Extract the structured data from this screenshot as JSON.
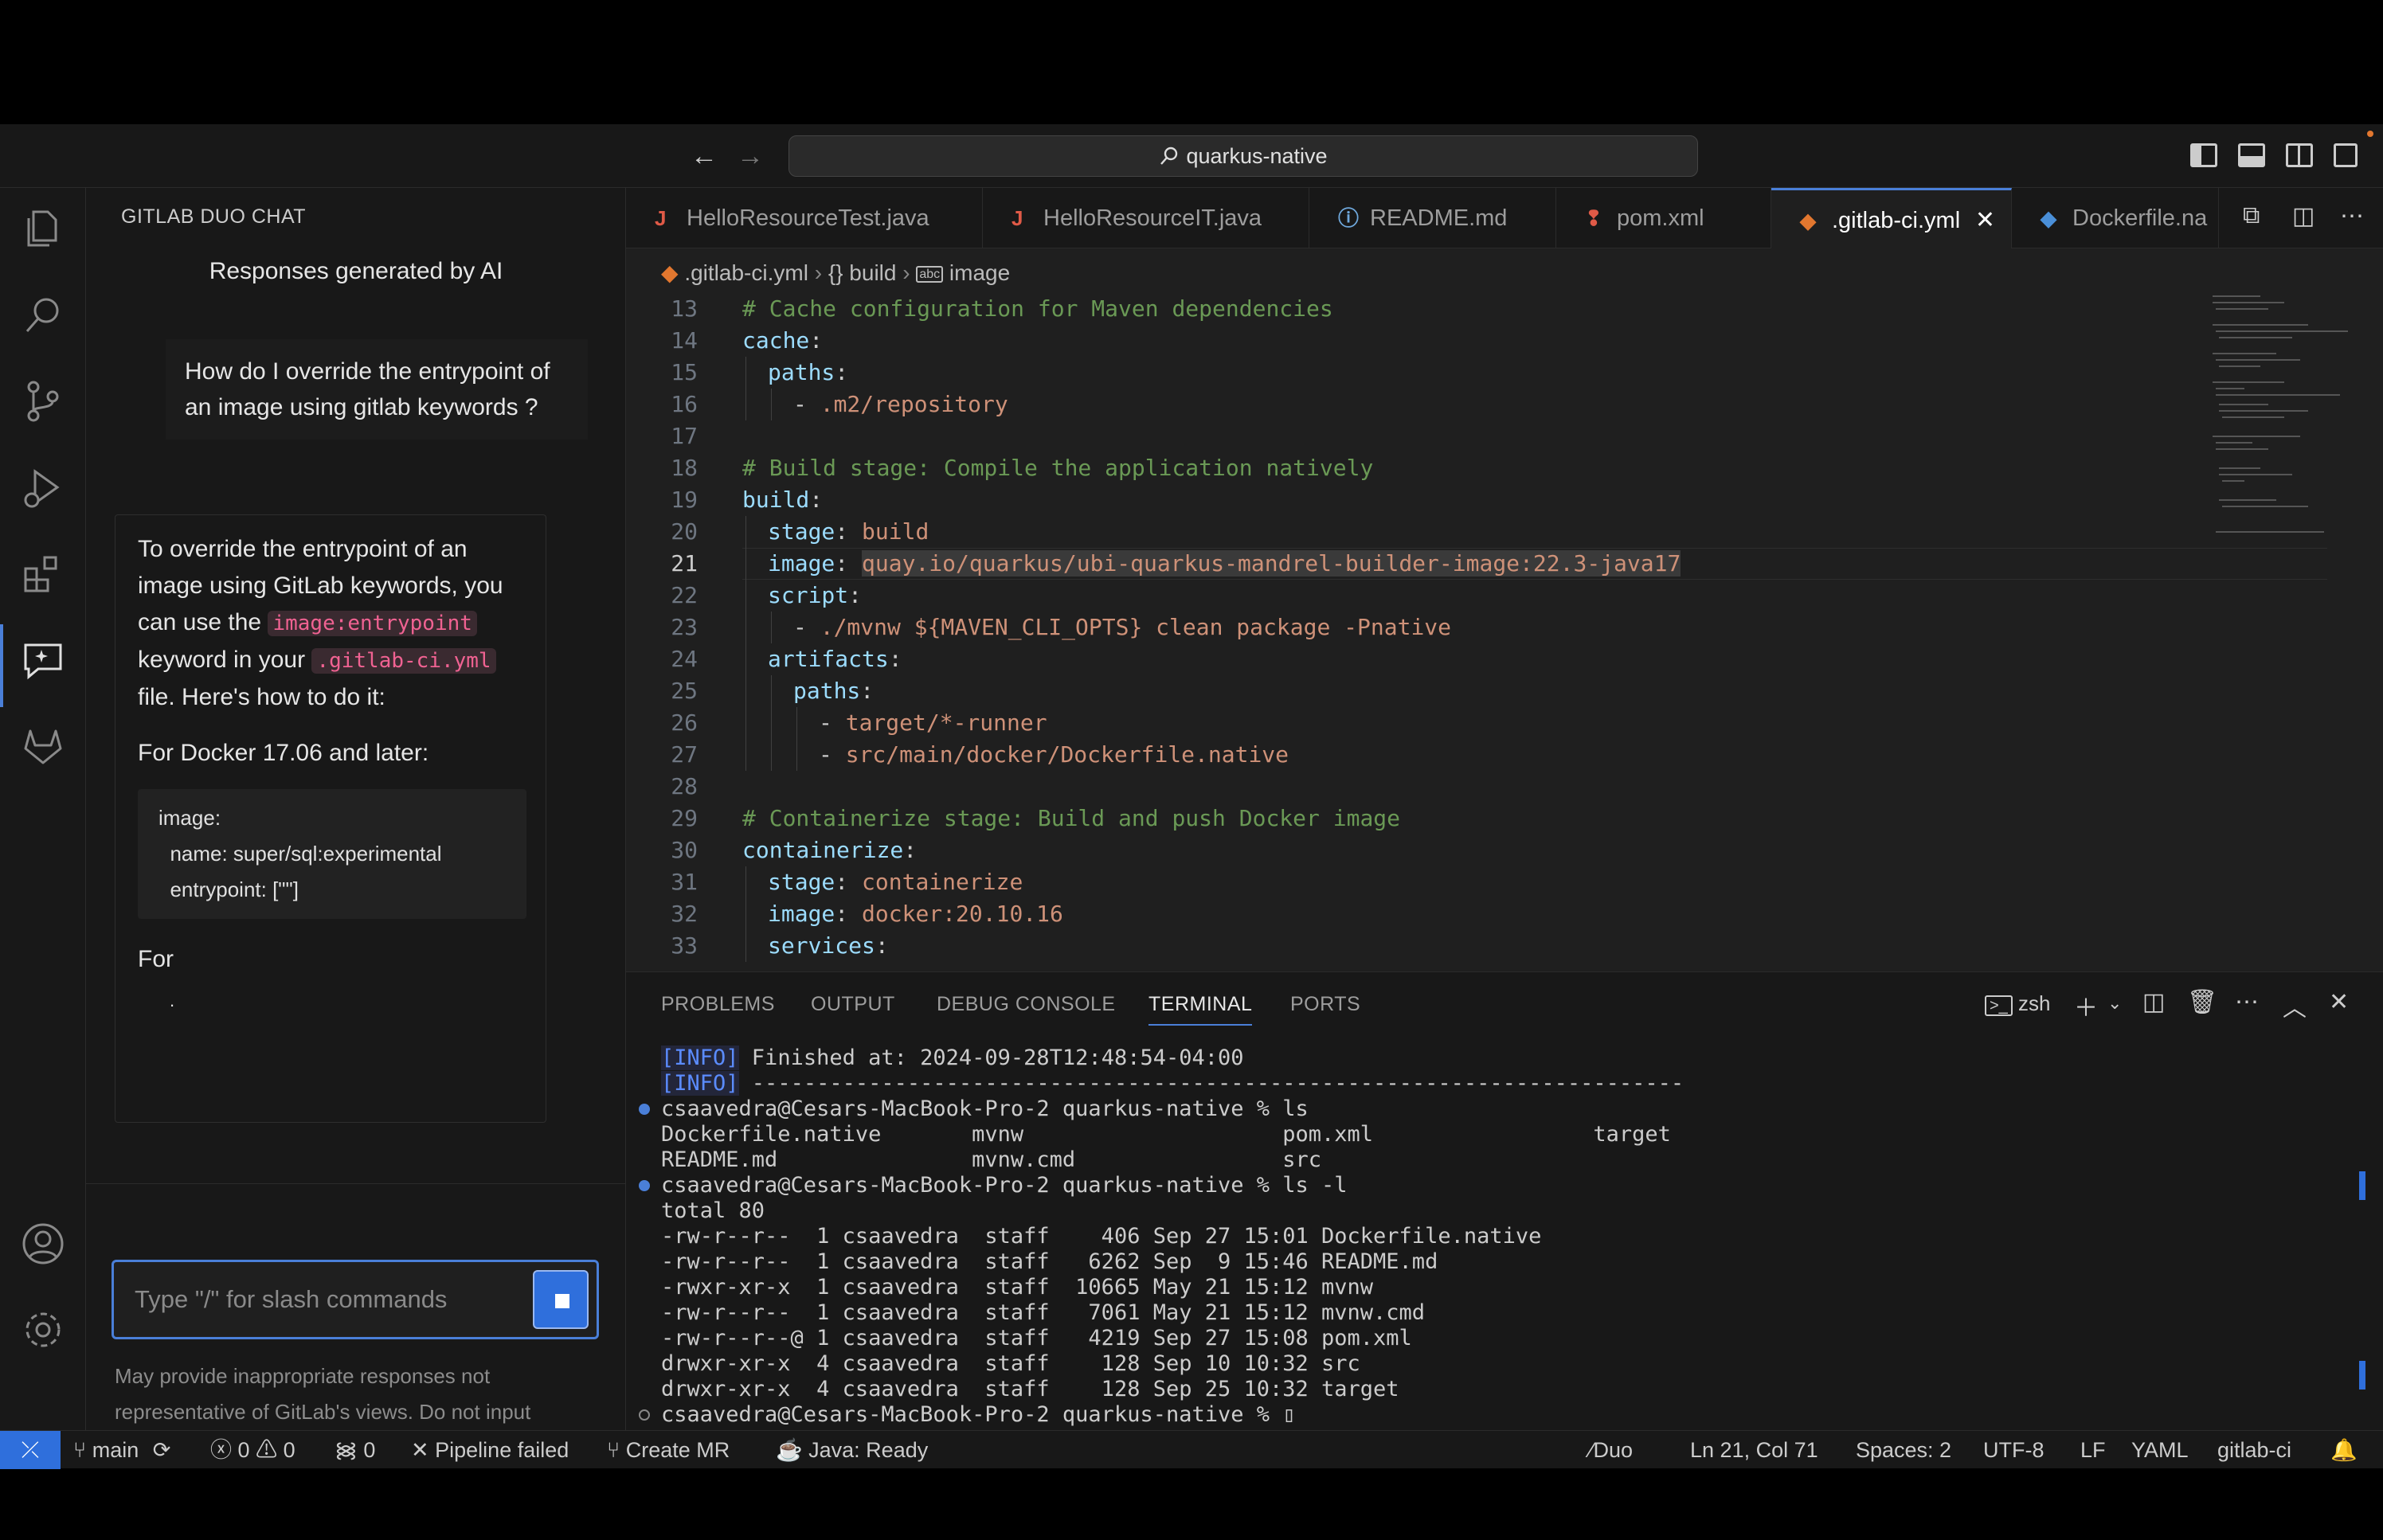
{
  "titlebar": {
    "search_text": "quarkus-native"
  },
  "chat": {
    "title": "GITLAB DUO CHAT",
    "subtitle": "Responses generated by AI",
    "question": "How do I override the entrypoint of an image using gitlab keywords ?",
    "answer_part1": "To override the entrypoint of an image using GitLab keywords, you can use the ",
    "answer_code1": "image:entrypoint",
    "answer_part2": " keyword in your ",
    "answer_code2": ".gitlab-ci.yml",
    "answer_part3": " file. Here's how to do it:",
    "answer_docker": "For Docker 17.06 and later:",
    "code_block": "image:\n  name: super/sql:experimental\n  entrypoint: [\"\"]",
    "answer_for": "For",
    "answer_dot": ".",
    "input_placeholder": "Type \"/\" for slash commands",
    "disclaimer": "May provide inappropriate responses not representative of GitLab's views. Do not input personal data."
  },
  "tabs": [
    {
      "label": "HelloResourceTest.java",
      "icon": "J",
      "color": "#e05a47"
    },
    {
      "label": "HelloResourceIT.java",
      "icon": "J",
      "color": "#e05a47"
    },
    {
      "label": "README.md",
      "icon": "ⓘ",
      "color": "#6fa8dc"
    },
    {
      "label": "pom.xml",
      "icon": "❢",
      "color": "#e05a47"
    },
    {
      "label": ".gitlab-ci.yml",
      "icon": "◆",
      "color": "#e2772f"
    },
    {
      "label": "Dockerfile.na",
      "icon": "◆",
      "color": "#4a8fd8"
    }
  ],
  "breadcrumb": {
    "file": ".gitlab-ci.yml",
    "section": "{} build",
    "key": "image"
  },
  "editor": {
    "current_line": 21,
    "lines": [
      {
        "n": "13",
        "indent": 0,
        "tokens": [
          {
            "c": "c",
            "t": "# Cache configuration for Maven dependencies"
          }
        ]
      },
      {
        "n": "14",
        "indent": 0,
        "tokens": [
          {
            "c": "k",
            "t": "cache"
          },
          {
            "c": "p",
            "t": ":"
          }
        ]
      },
      {
        "n": "15",
        "indent": 1,
        "tokens": [
          {
            "c": "k",
            "t": "paths"
          },
          {
            "c": "p",
            "t": ":"
          }
        ]
      },
      {
        "n": "16",
        "indent": 2,
        "tokens": [
          {
            "c": "p",
            "t": "- "
          },
          {
            "c": "s",
            "t": ".m2/repository"
          }
        ]
      },
      {
        "n": "17",
        "indent": 0,
        "tokens": []
      },
      {
        "n": "18",
        "indent": 0,
        "tokens": [
          {
            "c": "c",
            "t": "# Build stage: Compile the application natively"
          }
        ]
      },
      {
        "n": "19",
        "indent": 0,
        "tokens": [
          {
            "c": "k",
            "t": "build"
          },
          {
            "c": "p",
            "t": ":"
          }
        ]
      },
      {
        "n": "20",
        "indent": 1,
        "tokens": [
          {
            "c": "k",
            "t": "stage"
          },
          {
            "c": "p",
            "t": ": "
          },
          {
            "c": "s",
            "t": "build"
          }
        ]
      },
      {
        "n": "21",
        "indent": 1,
        "tokens": [
          {
            "c": "k",
            "t": "image"
          },
          {
            "c": "p",
            "t": ": "
          },
          {
            "c": "s hl",
            "t": "quay.io/quarkus/ubi-quarkus-mandrel-builder-image:22.3-java17"
          }
        ]
      },
      {
        "n": "22",
        "indent": 1,
        "tokens": [
          {
            "c": "k",
            "t": "script"
          },
          {
            "c": "p",
            "t": ":"
          }
        ]
      },
      {
        "n": "23",
        "indent": 2,
        "tokens": [
          {
            "c": "p",
            "t": "- "
          },
          {
            "c": "s",
            "t": "./mvnw ${MAVEN_CLI_OPTS} clean package -Pnative"
          }
        ]
      },
      {
        "n": "24",
        "indent": 1,
        "tokens": [
          {
            "c": "k",
            "t": "artifacts"
          },
          {
            "c": "p",
            "t": ":"
          }
        ]
      },
      {
        "n": "25",
        "indent": 2,
        "tokens": [
          {
            "c": "k",
            "t": "paths"
          },
          {
            "c": "p",
            "t": ":"
          }
        ]
      },
      {
        "n": "26",
        "indent": 3,
        "tokens": [
          {
            "c": "p",
            "t": "- "
          },
          {
            "c": "s",
            "t": "target/*-runner"
          }
        ]
      },
      {
        "n": "27",
        "indent": 3,
        "tokens": [
          {
            "c": "p",
            "t": "- "
          },
          {
            "c": "s",
            "t": "src/main/docker/Dockerfile.native"
          }
        ]
      },
      {
        "n": "28",
        "indent": 0,
        "tokens": []
      },
      {
        "n": "29",
        "indent": 0,
        "tokens": [
          {
            "c": "c",
            "t": "# Containerize stage: Build and push Docker image"
          }
        ]
      },
      {
        "n": "30",
        "indent": 0,
        "tokens": [
          {
            "c": "k",
            "t": "containerize"
          },
          {
            "c": "p",
            "t": ":"
          }
        ]
      },
      {
        "n": "31",
        "indent": 1,
        "tokens": [
          {
            "c": "k",
            "t": "stage"
          },
          {
            "c": "p",
            "t": ": "
          },
          {
            "c": "s",
            "t": "containerize"
          }
        ]
      },
      {
        "n": "32",
        "indent": 1,
        "tokens": [
          {
            "c": "k",
            "t": "image"
          },
          {
            "c": "p",
            "t": ": "
          },
          {
            "c": "s",
            "t": "docker:20.10.16"
          }
        ]
      },
      {
        "n": "33",
        "indent": 1,
        "tokens": [
          {
            "c": "k",
            "t": "services"
          },
          {
            "c": "p",
            "t": ":"
          }
        ]
      }
    ]
  },
  "panel": {
    "tabs": [
      "PROBLEMS",
      "OUTPUT",
      "DEBUG CONSOLE",
      "TERMINAL",
      "PORTS"
    ],
    "active_tab": "TERMINAL",
    "shell": "zsh",
    "terminal_lines": [
      {
        "dot": "",
        "info": "[INFO]",
        "t": " Finished at: 2024-09-28T12:48:54-04:00"
      },
      {
        "dot": "",
        "info": "[INFO]",
        "t": " ------------------------------------------------------------------------"
      },
      {
        "dot": "blue",
        "info": "",
        "t": "csaavedra@Cesars-MacBook-Pro-2 quarkus-native % ls"
      },
      {
        "dot": "",
        "info": "",
        "t": "Dockerfile.native       mvnw                    pom.xml                 target"
      },
      {
        "dot": "",
        "info": "",
        "t": "README.md               mvnw.cmd                src"
      },
      {
        "dot": "blue",
        "info": "",
        "t": "csaavedra@Cesars-MacBook-Pro-2 quarkus-native % ls -l"
      },
      {
        "dot": "",
        "info": "",
        "t": "total 80"
      },
      {
        "dot": "",
        "info": "",
        "t": "-rw-r--r--  1 csaavedra  staff    406 Sep 27 15:01 Dockerfile.native"
      },
      {
        "dot": "",
        "info": "",
        "t": "-rw-r--r--  1 csaavedra  staff   6262 Sep  9 15:46 README.md"
      },
      {
        "dot": "",
        "info": "",
        "t": "-rwxr-xr-x  1 csaavedra  staff  10665 May 21 15:12 mvnw"
      },
      {
        "dot": "",
        "info": "",
        "t": "-rw-r--r--  1 csaavedra  staff   7061 May 21 15:12 mvnw.cmd"
      },
      {
        "dot": "",
        "info": "",
        "t": "-rw-r--r--@ 1 csaavedra  staff   4219 Sep 27 15:08 pom.xml"
      },
      {
        "dot": "",
        "info": "",
        "t": "drwxr-xr-x  4 csaavedra  staff    128 Sep 10 10:32 src"
      },
      {
        "dot": "",
        "info": "",
        "t": "drwxr-xr-x  4 csaavedra  staff    128 Sep 25 10:32 target"
      },
      {
        "dot": "gray",
        "info": "",
        "t": "csaavedra@Cesars-MacBook-Pro-2 quarkus-native % ▯"
      }
    ]
  },
  "statusbar": {
    "branch": "main",
    "errors": "0",
    "warnings": "0",
    "ports": "0",
    "pipeline": "Pipeline failed",
    "create_mr": "Create MR",
    "java": "Java: Ready",
    "duo": "Duo",
    "position": "Ln 21, Col 71",
    "spaces": "Spaces: 2",
    "encoding": "UTF-8",
    "eol": "LF",
    "language": "YAML",
    "schema": "gitlab-ci"
  },
  "colors": {
    "accent": "#2f6fdc",
    "keyword": "#9cdcfe",
    "comment": "#6a9955",
    "string": "#ce9178"
  }
}
